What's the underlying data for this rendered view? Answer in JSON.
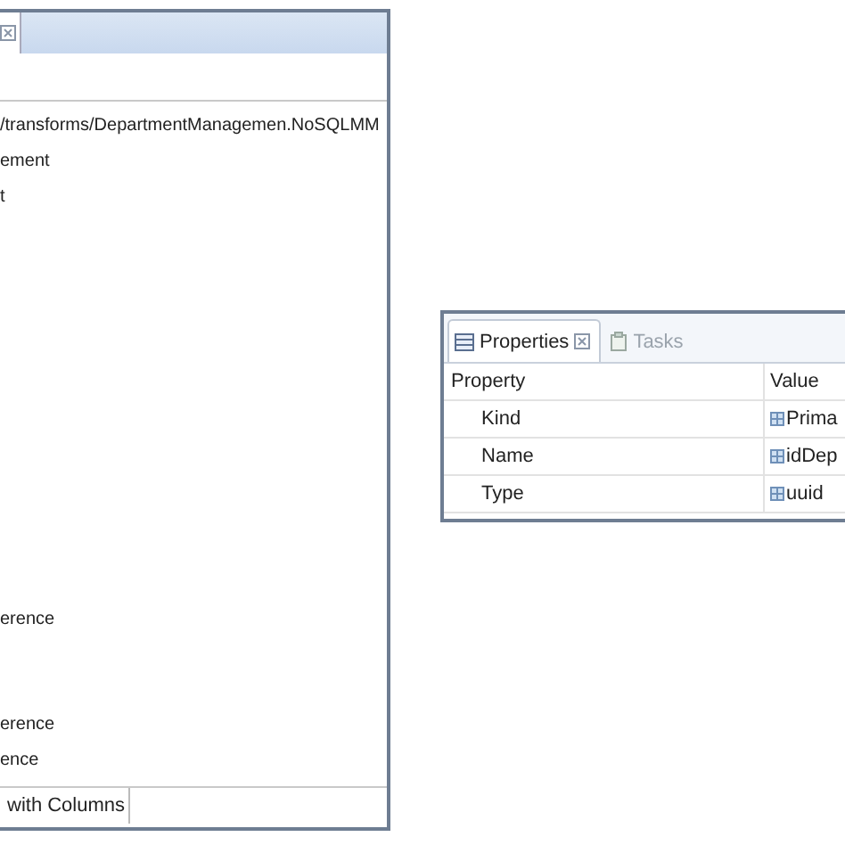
{
  "editor": {
    "tree_top": [
      "/transforms/DepartmentManagemen.NoSQLMM",
      "ement",
      "t"
    ],
    "tree_middle": [
      "erence"
    ],
    "tree_bottom": [
      "erence",
      "ence"
    ],
    "bottom_tabs": [
      {
        "label": "with Columns",
        "selected": true
      }
    ]
  },
  "properties_view": {
    "tabs": [
      {
        "label": "Properties",
        "selected": true
      },
      {
        "label": "Tasks",
        "selected": false
      }
    ],
    "columns": [
      "Property",
      "Value"
    ],
    "rows": [
      {
        "property": "Kind",
        "value": "Prima"
      },
      {
        "property": "Name",
        "value": "idDep"
      },
      {
        "property": "Type",
        "value": "uuid"
      }
    ]
  }
}
